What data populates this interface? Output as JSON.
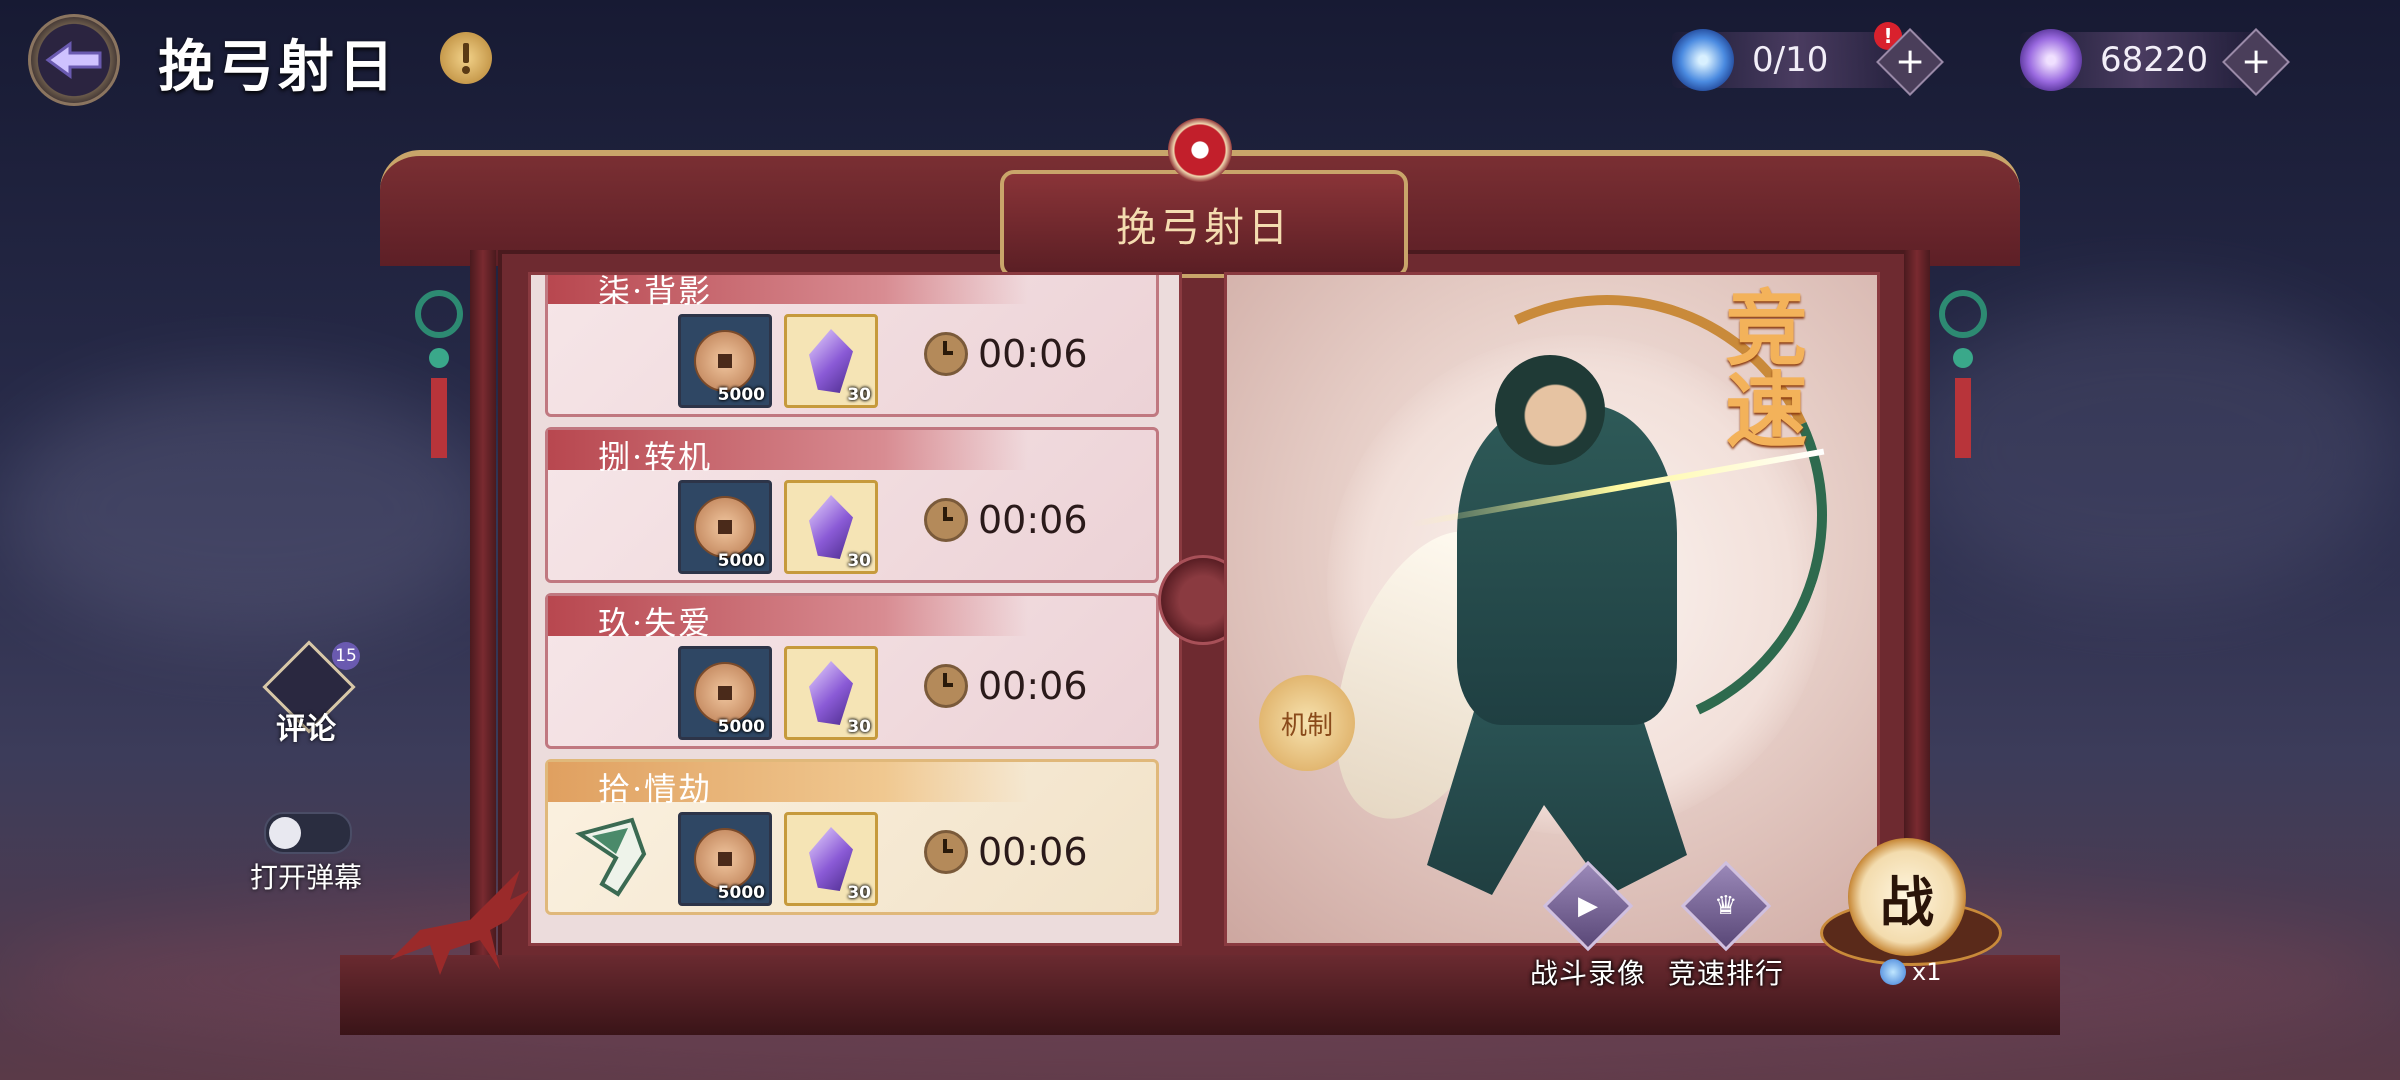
{
  "header": {
    "back_icon": "back-arrow-icon",
    "title": "挽弓射日",
    "hint_icon": "exclamation-icon"
  },
  "currencies": [
    {
      "icon": "stamina-orb-icon",
      "value": "0/10",
      "alert": "!"
    },
    {
      "icon": "purple-crystal-icon",
      "value": "68220"
    }
  ],
  "plaque": {
    "title": "挽弓射日"
  },
  "levels": [
    {
      "name": "柒·背影",
      "rewards": [
        {
          "icon": "copper-coin-icon",
          "qty": "5000"
        },
        {
          "icon": "purple-crystal-icon",
          "qty": "30"
        }
      ],
      "timer": "00:06",
      "highlight": false
    },
    {
      "name": "捌·转机",
      "rewards": [
        {
          "icon": "copper-coin-icon",
          "qty": "5000"
        },
        {
          "icon": "purple-crystal-icon",
          "qty": "30"
        }
      ],
      "timer": "00:06",
      "highlight": false
    },
    {
      "name": "玖·失爱",
      "rewards": [
        {
          "icon": "copper-coin-icon",
          "qty": "5000"
        },
        {
          "icon": "purple-crystal-icon",
          "qty": "30"
        }
      ],
      "timer": "00:06",
      "highlight": false
    },
    {
      "name": "拾·情劫",
      "rewards": [
        {
          "icon": "copper-coin-icon",
          "qty": "5000"
        },
        {
          "icon": "purple-crystal-icon",
          "qty": "30"
        }
      ],
      "timer": "00:06",
      "highlight": true,
      "extra_icon": "arrowhead-item-icon"
    }
  ],
  "showcase": {
    "mode_text": "竞速",
    "badge_text": "机制"
  },
  "actions": {
    "replay_label": "战斗录像",
    "ranking_label": "竞速排行",
    "fight_label": "战",
    "cost": "x1"
  },
  "sidebar": {
    "comment_label": "评论",
    "comment_count": "15",
    "danmaku_label": "打开弹幕"
  },
  "colors": {
    "frame_red": "#6e2a30",
    "gold_accent": "#c9a56a",
    "timer_text": "#2a1a1a"
  }
}
